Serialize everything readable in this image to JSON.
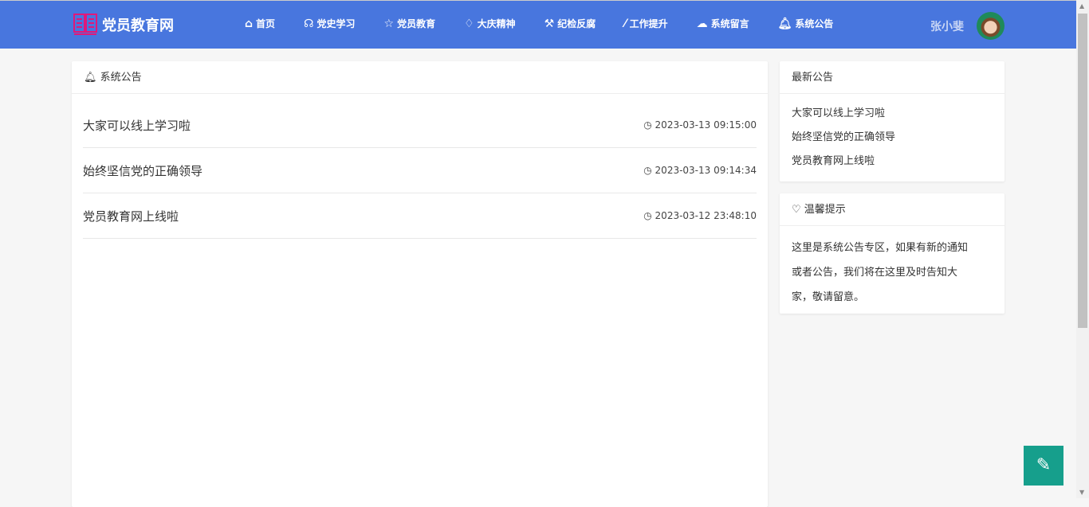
{
  "header": {
    "site_name": "党员教育网",
    "user_name": "张小斐",
    "menu": [
      {
        "icon": "home-icon",
        "label": "首页"
      },
      {
        "icon": "headphones-icon",
        "label": "党史学习"
      },
      {
        "icon": "star-icon",
        "label": "党员教育"
      },
      {
        "icon": "lightbulb-icon",
        "label": "大庆精神"
      },
      {
        "icon": "gavel-icon",
        "label": "纪检反腐"
      },
      {
        "icon": "magic-icon",
        "label": "工作提升"
      },
      {
        "icon": "comments-icon",
        "label": "系统留言"
      },
      {
        "icon": "bell-icon",
        "label": "系统公告"
      }
    ]
  },
  "main": {
    "title": "系统公告",
    "items": [
      {
        "title": "大家可以线上学习啦",
        "time": "2023-03-13 09:15:00"
      },
      {
        "title": "始终坚信党的正确领导",
        "time": "2023-03-13 09:14:34"
      },
      {
        "title": "党员教育网上线啦",
        "time": "2023-03-12 23:48:10"
      }
    ]
  },
  "latest": {
    "title": "最新公告",
    "items": [
      "大家可以线上学习啦",
      "始终坚信党的正确领导",
      "党员教育网上线啦"
    ]
  },
  "tips": {
    "title": "温馨提示",
    "text": "这里是系统公告专区，如果有新的通知或者公告，我们将在这里及时告知大家，敬请留意。"
  },
  "colors": {
    "nav": "#4876de",
    "fab": "#169f8c"
  }
}
